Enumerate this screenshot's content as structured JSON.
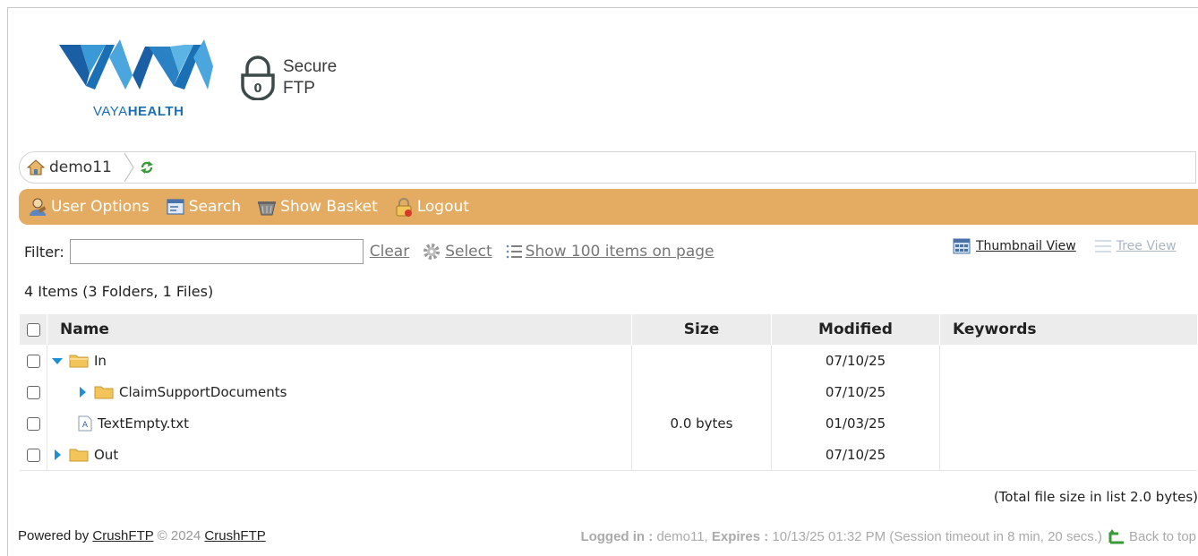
{
  "header": {
    "logo_text_light": "VAYA",
    "logo_text_bold": "HEALTH",
    "secure_label_line1": "Secure",
    "secure_label_line2": "FTP",
    "lock_digit": "0"
  },
  "breadcrumb": {
    "home_label": "demo11"
  },
  "menu": {
    "user_options": "User Options",
    "search": "Search",
    "show_basket": "Show Basket",
    "logout": "Logout"
  },
  "filter": {
    "label": "Filter:",
    "value": "",
    "clear": "Clear",
    "select": "Select",
    "show_items": "Show 100 items on page"
  },
  "views": {
    "thumbnail": "Thumbnail View",
    "tree": "Tree View"
  },
  "items_count": "4 Items (3 Folders, 1 Files)",
  "table": {
    "columns": [
      "Name",
      "Size",
      "Modified",
      "Keywords"
    ],
    "rows": [
      {
        "name": "In",
        "size": "",
        "modified": "07/10/25",
        "keywords": "",
        "type": "folder",
        "expanded": true
      },
      {
        "name": "ClaimSupportDocuments",
        "size": "",
        "modified": "07/10/25",
        "keywords": "",
        "type": "folder",
        "expanded": false
      },
      {
        "name": "TextEmpty.txt",
        "size": "0.0 bytes",
        "modified": "01/03/25",
        "keywords": "",
        "type": "file"
      },
      {
        "name": "Out",
        "size": "",
        "modified": "07/10/25",
        "keywords": "",
        "type": "folder",
        "expanded": false
      }
    ]
  },
  "total_size": "(Total file size in list 2.0 bytes)",
  "footer": {
    "powered_by": "Powered by",
    "crushftp_link": "CrushFTP",
    "copyright": "© 2024",
    "crushftp_link2": "CrushFTP",
    "logged_in_label": "Logged in :",
    "logged_in_user": "demo11,",
    "expires_label": "Expires :",
    "expires_value": "10/13/25 01:32 PM (Session timeout in 8 min, 20 secs.)",
    "back_to_top": "Back to top"
  },
  "colors": {
    "menu_bar": "#e3ac62",
    "brand_blue": "#1a6fb5",
    "brand_light_blue": "#4aa6dc",
    "triangle_blue": "#1e90d6",
    "folder_yellow": "#f2c45a"
  }
}
